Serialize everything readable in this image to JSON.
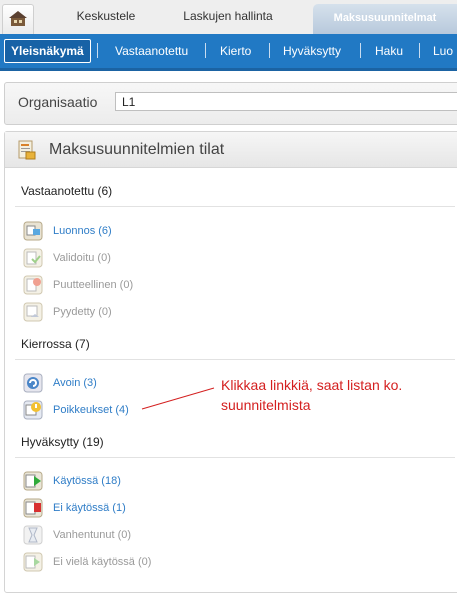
{
  "top_tabs": {
    "home_icon": "home-icon",
    "items": [
      {
        "label": "Keskustele"
      },
      {
        "label": "Laskujen hallinta"
      },
      {
        "label": "Maksusuunnitelmat",
        "active": true
      }
    ]
  },
  "sub_nav": {
    "items": [
      {
        "label": "Yleisnäkymä",
        "active": true
      },
      {
        "label": "Vastaanotettu"
      },
      {
        "label": "Kierto"
      },
      {
        "label": "Hyväksytty"
      },
      {
        "label": "Haku"
      },
      {
        "label": "Luo"
      }
    ]
  },
  "organization": {
    "label": "Organisaatio",
    "value": "L1"
  },
  "panel": {
    "title": "Maksusuunnitelmien tilat",
    "sections": [
      {
        "title": "Vastaanotettu (6)",
        "items": [
          {
            "label": "Luonnos (6)",
            "icon": "draft-icon",
            "link": true
          },
          {
            "label": "Validoitu (0)",
            "icon": "validated-icon",
            "link": false
          },
          {
            "label": "Puutteellinen (0)",
            "icon": "incomplete-icon",
            "link": false
          },
          {
            "label": "Pyydetty (0)",
            "icon": "requested-icon",
            "link": false
          }
        ]
      },
      {
        "title": "Kierrossa (7)",
        "items": [
          {
            "label": "Avoin (3)",
            "icon": "open-icon",
            "link": true
          },
          {
            "label": "Poikkeukset (4)",
            "icon": "exceptions-icon",
            "link": true
          }
        ]
      },
      {
        "title": "Hyväksytty (19)",
        "items": [
          {
            "label": "Käytössä (18)",
            "icon": "in-use-icon",
            "link": true
          },
          {
            "label": "Ei käytössä (1)",
            "icon": "not-in-use-icon",
            "link": true
          },
          {
            "label": "Vanhentunut (0)",
            "icon": "expired-icon",
            "link": false
          },
          {
            "label": "Ei vielä käytössä (0)",
            "icon": "not-yet-in-use-icon",
            "link": false
          }
        ]
      }
    ]
  },
  "annotation": {
    "line1": "Klikkaa linkkiä, saat listan ko.",
    "line2": "suunnitelmista",
    "color": "#d42020"
  },
  "colors": {
    "nav_blue": "#2179c4",
    "link_blue": "#2f7dc7",
    "disabled_gray": "#9a9a9a"
  }
}
